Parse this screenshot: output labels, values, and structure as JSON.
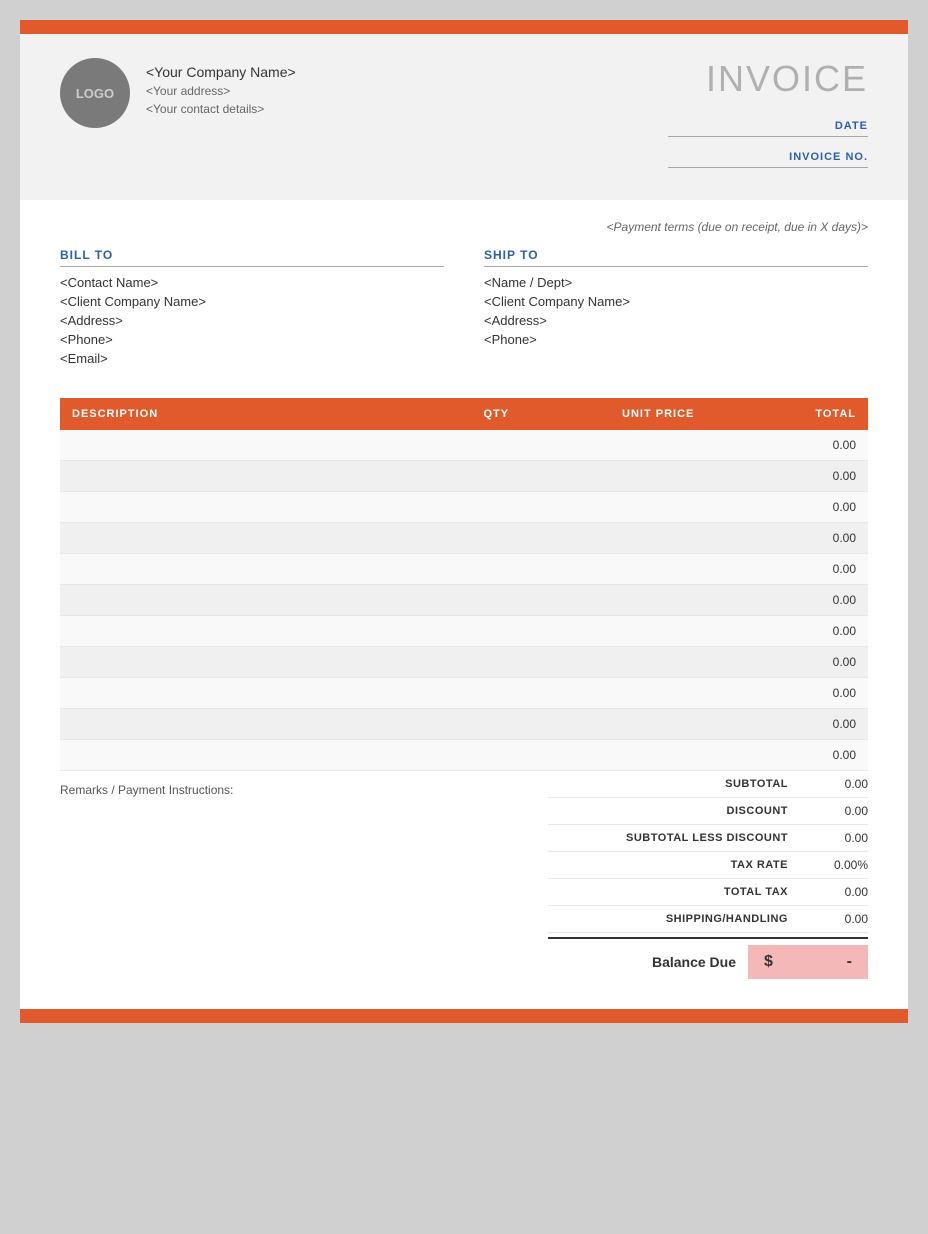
{
  "page": {
    "top_bar_color": "#e05a2b",
    "bottom_bar_color": "#e05a2b"
  },
  "header": {
    "logo_text": "LOGO",
    "company_name": "<Your Company Name>",
    "company_address": "<Your address>",
    "company_contact": "<Your contact details>",
    "invoice_title": "INVOICE",
    "date_label": "DATE",
    "invoice_no_label": "INVOICE NO."
  },
  "billing": {
    "payment_terms": "<Payment terms (due on receipt, due in X days)>",
    "bill_to_header": "BILL TO",
    "bill_to_contact": "<Contact Name>",
    "bill_to_company": "<Client Company Name>",
    "bill_to_address": "<Address>",
    "bill_to_phone": "<Phone>",
    "bill_to_email": "<Email>",
    "ship_to_header": "SHIP TO",
    "ship_to_name": "<Name / Dept>",
    "ship_to_company": "<Client Company Name>",
    "ship_to_address": "<Address>",
    "ship_to_phone": "<Phone>"
  },
  "table": {
    "col_description": "DESCRIPTION",
    "col_qty": "QTY",
    "col_unit_price": "UNIT PRICE",
    "col_total": "TOTAL",
    "rows": [
      {
        "description": "",
        "qty": "",
        "unit_price": "",
        "total": "0.00"
      },
      {
        "description": "",
        "qty": "",
        "unit_price": "",
        "total": "0.00"
      },
      {
        "description": "",
        "qty": "",
        "unit_price": "",
        "total": "0.00"
      },
      {
        "description": "",
        "qty": "",
        "unit_price": "",
        "total": "0.00"
      },
      {
        "description": "",
        "qty": "",
        "unit_price": "",
        "total": "0.00"
      },
      {
        "description": "",
        "qty": "",
        "unit_price": "",
        "total": "0.00"
      },
      {
        "description": "",
        "qty": "",
        "unit_price": "",
        "total": "0.00"
      },
      {
        "description": "",
        "qty": "",
        "unit_price": "",
        "total": "0.00"
      },
      {
        "description": "",
        "qty": "",
        "unit_price": "",
        "total": "0.00"
      },
      {
        "description": "",
        "qty": "",
        "unit_price": "",
        "total": "0.00"
      },
      {
        "description": "",
        "qty": "",
        "unit_price": "",
        "total": "0.00"
      }
    ]
  },
  "summary": {
    "remarks_label": "Remarks / Payment Instructions:",
    "subtotal_label": "SUBTOTAL",
    "subtotal_value": "0.00",
    "discount_label": "DISCOUNT",
    "discount_value": "0.00",
    "subtotal_less_discount_label": "SUBTOTAL LESS DISCOUNT",
    "subtotal_less_discount_value": "0.00",
    "tax_rate_label": "TAX RATE",
    "tax_rate_value": "0.00%",
    "total_tax_label": "TOTAL TAX",
    "total_tax_value": "0.00",
    "shipping_label": "SHIPPING/HANDLING",
    "shipping_value": "0.00",
    "balance_due_label": "Balance Due",
    "balance_due_currency": "$",
    "balance_due_value": "-"
  }
}
